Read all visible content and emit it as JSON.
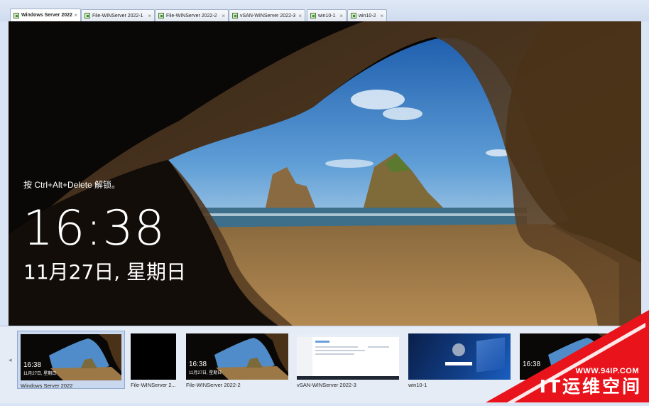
{
  "tabs": [
    {
      "label": "Windows Server 2022",
      "active": true
    },
    {
      "label": "File-WINServer 2022-1",
      "active": false
    },
    {
      "label": "File-WINServer 2022-2",
      "active": false
    },
    {
      "label": "vSAN-WINServer 2022-3",
      "active": false
    },
    {
      "label": "win10-1",
      "active": false
    },
    {
      "label": "win10-2",
      "active": false
    }
  ],
  "tab_close_glyph": "×",
  "lockscreen": {
    "hint": "按 Ctrl+Alt+Delete 解锁。",
    "time": "16:38",
    "date": "11月27日, 星期日"
  },
  "thumbnails": [
    {
      "caption": "Windows Server 2022",
      "kind": "lockscreen",
      "time": "16:38",
      "date": "11月27日, 星期日",
      "selected": true
    },
    {
      "caption": "File-WINServer 2...",
      "kind": "black",
      "selected": false
    },
    {
      "caption": "File-WINServer 2022-2",
      "kind": "lockscreen",
      "time": "16:38",
      "date": "11月27日, 星期日",
      "selected": false
    },
    {
      "caption": "vSAN-WINServer 2022-3",
      "kind": "desktop",
      "selected": false
    },
    {
      "caption": "win10-1",
      "kind": "win10",
      "selected": false
    },
    {
      "caption": "",
      "kind": "lockscreen",
      "time": "16:38",
      "date": "",
      "selected": false
    }
  ],
  "strip_scroll_glyph": "◂",
  "watermark": {
    "url": "WWW.94IP.COM",
    "name": "IT运维空间"
  },
  "colors": {
    "tab_bar": "#dfe8f6",
    "selection": "#c9d8ee",
    "watermark_red": "#e8131b"
  }
}
